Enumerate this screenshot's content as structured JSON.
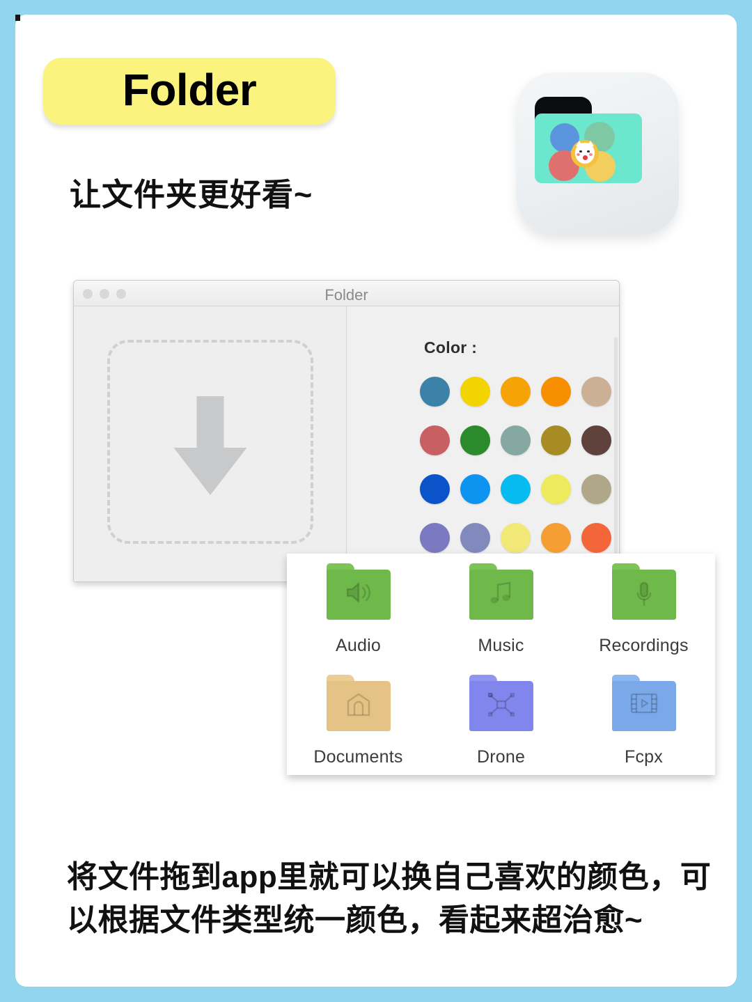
{
  "page": {
    "background_color": "#92d5ef",
    "card_color": "#ffffff"
  },
  "header": {
    "badge_title": "Folder",
    "badge_color": "#faf47f",
    "subtitle": "让文件夹更好看~"
  },
  "app_icon": {
    "name": "folder-app-icon",
    "folder_color": "#6ae7cc",
    "tab_color": "#0b0c10",
    "dots": [
      {
        "name": "blue-dot",
        "color": "#5b95de"
      },
      {
        "name": "green-dot",
        "color": "#7ec9a4"
      },
      {
        "name": "red-dot",
        "color": "#e0706e"
      },
      {
        "name": "yellow-dot",
        "color": "#f2ce5e"
      }
    ],
    "cat_badge_color": "#f5c23f"
  },
  "app_window": {
    "title": "Folder",
    "traffic_lights": [
      "close",
      "minimize",
      "zoom"
    ],
    "drop_pane": {
      "icon": "download-arrow-icon",
      "hint": ""
    },
    "color_pane": {
      "label": "Color :",
      "swatches": [
        [
          "#3c82a8",
          "#f2d500",
          "#f5a306",
          "#f78f00",
          "#cbb095"
        ],
        [
          "#c85f62",
          "#2b8a2b",
          "#85a8a2",
          "#a68c22",
          "#5e423b"
        ],
        [
          "#0a53c8",
          "#0c94f0",
          "#06bbef",
          "#eeea5d",
          "#b0a688"
        ],
        [
          "#7b79bf",
          "#8289bd",
          "#f2e877",
          "#f59e33",
          "#f26639"
        ],
        [
          "#b0abcb",
          "#666a96",
          "#6b4c2d",
          "#f7e7dc",
          "#cba49c"
        ]
      ]
    }
  },
  "folder_panel": {
    "folders": [
      {
        "label": "Audio",
        "color": "#6fb94a",
        "tab_color": "#7cc455",
        "icon": "speaker-icon"
      },
      {
        "label": "Music",
        "color": "#6fb94a",
        "tab_color": "#7cc455",
        "icon": "music-note-icon"
      },
      {
        "label": "Recordings",
        "color": "#6fb94a",
        "tab_color": "#7cc455",
        "icon": "microphone-icon"
      },
      {
        "label": "Documents",
        "color": "#e5c285",
        "tab_color": "#eccd96",
        "icon": "document-icon"
      },
      {
        "label": "Drone",
        "color": "#8186ec",
        "tab_color": "#9095f0",
        "icon": "drone-icon"
      },
      {
        "label": "Fcpx",
        "color": "#7aa8e8",
        "tab_color": "#8cb6ef",
        "icon": "film-strip-icon"
      }
    ]
  },
  "caption": {
    "text": "将文件拖到app里就可以换自己喜欢的颜色，可以根据文件类型统一颜色，看起来超治愈~"
  }
}
